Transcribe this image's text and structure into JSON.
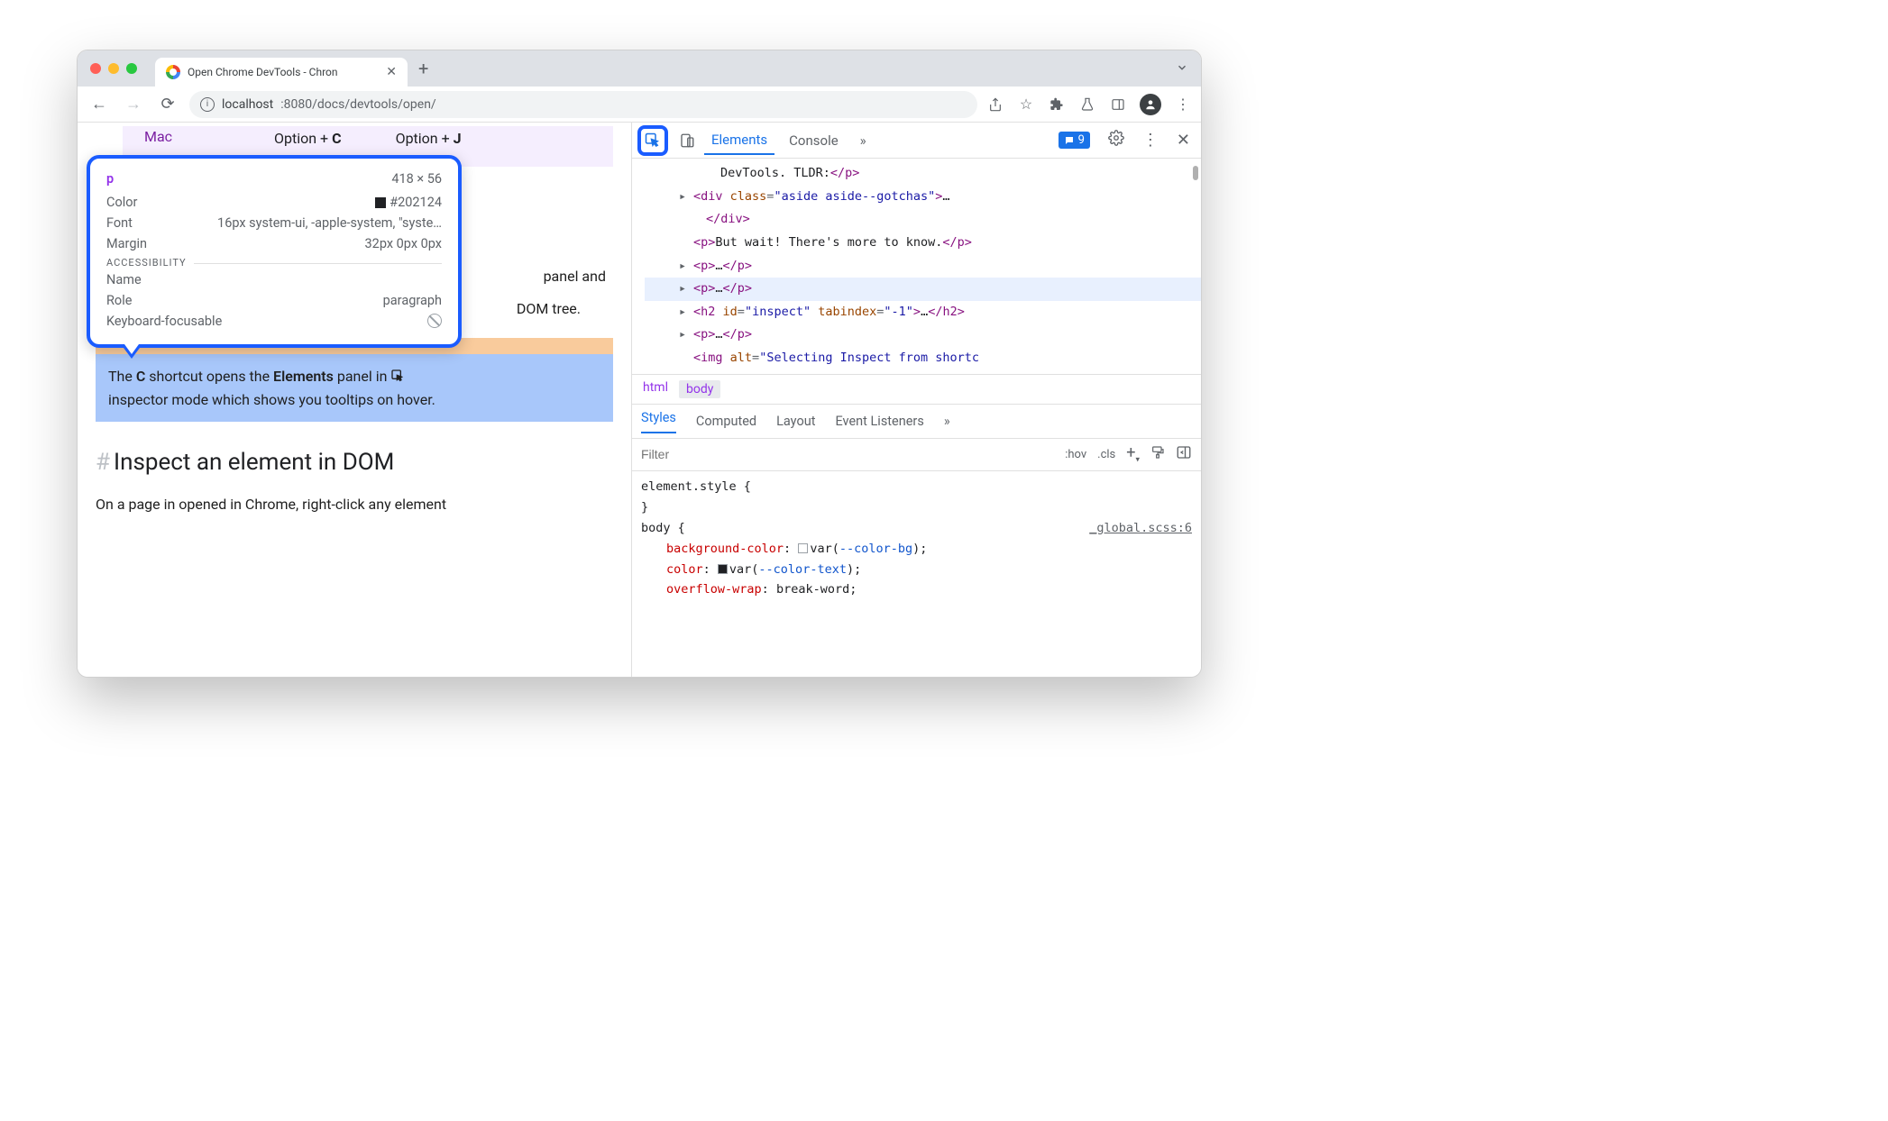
{
  "window": {
    "tab_title": "Open Chrome DevTools - Chron",
    "url_host": "localhost",
    "url_port_path": ":8080/docs/devtools/open/"
  },
  "page": {
    "mac_label": "Mac",
    "shortcut1": "Option + ",
    "shortcut1_key": "C",
    "shortcut2": "Option + ",
    "shortcut2_key": "J",
    "partial_text1": " panel and",
    "partial_text2": "DOM tree.",
    "hl_pre": "The ",
    "hl_key": "C",
    "hl_mid": " shortcut opens the ",
    "hl_panel": "Elements",
    "hl_post": " panel in ",
    "hl_line2": "inspector mode which shows you tooltips on hover.",
    "h2": "Inspect an element in DOM",
    "body_text": "On a page in opened in Chrome, right-click any element"
  },
  "tooltip": {
    "tag": "p",
    "dims": "418 × 56",
    "rows": {
      "color_label": "Color",
      "color_value": "#202124",
      "font_label": "Font",
      "font_value": "16px system-ui, -apple-system, \"syste…",
      "margin_label": "Margin",
      "margin_value": "32px 0px 0px"
    },
    "a11y_label": "ACCESSIBILITY",
    "a11y": {
      "name_label": "Name",
      "name_value": "",
      "role_label": "Role",
      "role_value": "paragraph",
      "kb_label": "Keyboard-focusable"
    }
  },
  "devtools": {
    "tabs": {
      "elements": "Elements",
      "console": "Console"
    },
    "badge_count": "9",
    "dom_lines": {
      "l0": "DevTools. TLDR:",
      "l1a": "<div class=\"aside aside--gotchas\">",
      "l1b": "…",
      "l1c": "</div>",
      "l2a": "<p>",
      "l2b": "But wait! There's more to know.",
      "l2c": "</p>",
      "l3": "<p>…</p>",
      "l4": "<p>…</p>",
      "l5a": "<h2 id=\"inspect\" tabindex=\"-1\">",
      "l5b": "…",
      "l5c": "</h2>",
      "l6": "<p>…</p>",
      "l7": "<img alt=\"Selecting Inspect from shortc"
    },
    "crumbs": {
      "html": "html",
      "body": "body"
    },
    "styles_tabs": {
      "styles": "Styles",
      "computed": "Computed",
      "layout": "Layout",
      "events": "Event Listeners"
    },
    "filter_placeholder": "Filter",
    "ctrl_hov": ":hov",
    "ctrl_cls": ".cls",
    "css": {
      "elstyle": "element.style {",
      "close": "}",
      "body_sel": "body {",
      "src": "_global.scss:6",
      "p1": "background-color",
      "v1": "var(",
      "vv1": "--color-bg",
      "v1e": ");",
      "p2": "color",
      "v2": "var(",
      "vv2": "--color-text",
      "v2e": ");",
      "p3": "overflow-wrap",
      "v3": "break-word;"
    }
  }
}
